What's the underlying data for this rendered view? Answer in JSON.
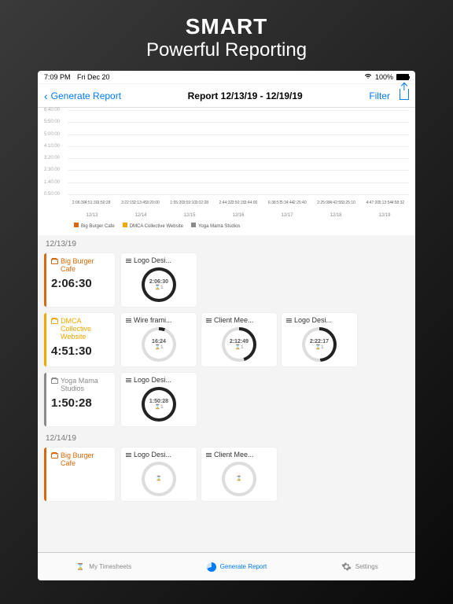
{
  "promo": {
    "line1": "SMART",
    "line2": "Powerful Reporting"
  },
  "statusbar": {
    "time": "7:09 PM",
    "date": "Fri Dec 20",
    "wifi": "100%",
    "battery_pct": "100%"
  },
  "nav": {
    "back": "Generate Report",
    "title": "Report 12/13/19 - 12/19/19",
    "filter": "Filter"
  },
  "chart_data": {
    "type": "bar",
    "title": "",
    "xlabel": "",
    "ylabel": "",
    "ylim": [
      0,
      6.67
    ],
    "ytick_format": "h:mm:ss",
    "yticks_hms": [
      "0:50:00",
      "1:40:00",
      "2:30:00",
      "3:20:00",
      "4:10:00",
      "5:00:00",
      "5:50:00",
      "6:40:00"
    ],
    "categories": [
      "12/13",
      "12/14",
      "12/15",
      "12/16",
      "12/17",
      "12/18",
      "12/19"
    ],
    "series": [
      {
        "name": "Big Burger Cafe",
        "color": "#d9680c",
        "labels_hms": [
          "2:06:30",
          "3:22:15",
          "1:55:20",
          "2:44:32",
          "6:38:57",
          "2:25:08",
          "4:47:20"
        ],
        "values": [
          2.108,
          3.371,
          1.922,
          2.742,
          6.649,
          2.419,
          4.789
        ]
      },
      {
        "name": "DMCA Collective Website",
        "color": "#f0a800",
        "labels_hms": [
          "4:51:30",
          "2:13:45",
          "3:59:10",
          "3:50:15",
          "5:34:44",
          "4:42:55",
          "5:13:54"
        ],
        "values": [
          4.858,
          2.229,
          3.986,
          3.837,
          5.579,
          4.715,
          5.232
        ]
      },
      {
        "name": "Yoga Mama Studios",
        "color": "#8a8a8a",
        "labels_hms": [
          "1:50:28",
          "3:20:00",
          "3:02:28",
          "3:44:00",
          "2:25:40",
          "3:25:10",
          "4:58:32"
        ],
        "values": [
          1.841,
          3.333,
          3.041,
          3.733,
          2.428,
          3.419,
          4.976
        ]
      }
    ]
  },
  "days": [
    {
      "date": "12/13/19",
      "projects": [
        {
          "name": "Big Burger Cafe",
          "color": "#d9680c",
          "total": "2:06:30",
          "tasks": [
            {
              "name": "Logo Desi...",
              "time": "2:06:30",
              "pct": 100,
              "count": "1"
            }
          ]
        },
        {
          "name": "DMCA Collective Website",
          "color": "#f0a800",
          "total": "4:51:30",
          "tasks": [
            {
              "name": "Wire frami...",
              "time": "16:24",
              "pct": 6,
              "count": "1"
            },
            {
              "name": "Client Mee...",
              "time": "2:12:49",
              "pct": 45,
              "count": "1"
            },
            {
              "name": "Logo Desi...",
              "time": "2:22:17",
              "pct": 49,
              "count": "1"
            }
          ]
        },
        {
          "name": "Yoga Mama Studios",
          "color": "#8a8a8a",
          "total": "1:50:28",
          "tasks": [
            {
              "name": "Logo Desi...",
              "time": "1:50:28",
              "pct": 100,
              "count": "1"
            }
          ]
        }
      ]
    },
    {
      "date": "12/14/19",
      "projects": [
        {
          "name": "Big Burger Cafe",
          "color": "#d9680c",
          "total": "",
          "tasks": [
            {
              "name": "Logo Desi...",
              "time": "",
              "pct": 0,
              "count": ""
            },
            {
              "name": "Client Mee...",
              "time": "",
              "pct": 0,
              "count": ""
            }
          ]
        }
      ]
    }
  ],
  "tabs": {
    "timesheets": "My Timesheets",
    "report": "Generate Report",
    "settings": "Settings"
  }
}
